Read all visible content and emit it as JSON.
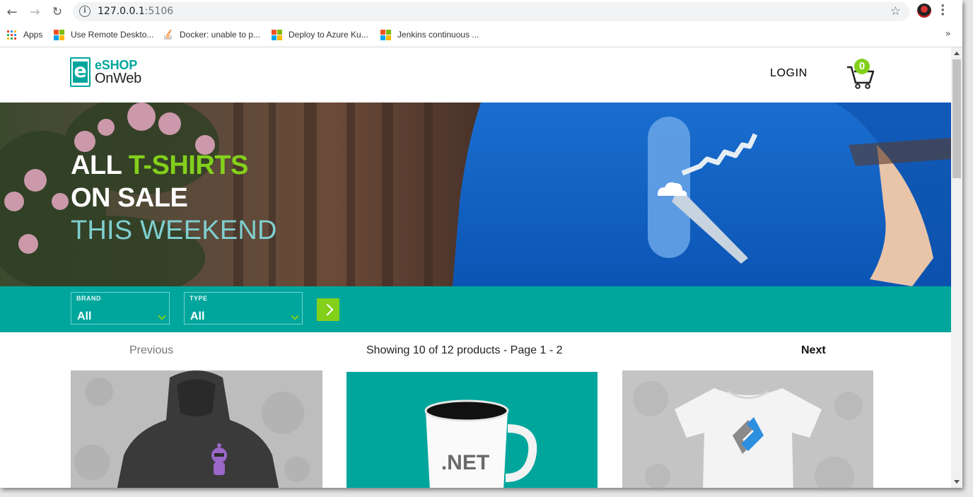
{
  "browser": {
    "url_host": "127.0.0.1",
    "url_port": ":5106",
    "bookmarks": [
      {
        "label": "Apps",
        "icon": "apps-grid-icon"
      },
      {
        "label": "Use Remote Deskto...",
        "icon": "microsoft-logo-icon"
      },
      {
        "label": "Docker: unable to p...",
        "icon": "stackoverflow-icon"
      },
      {
        "label": "Deploy to Azure Ku...",
        "icon": "microsoft-logo-icon"
      },
      {
        "label": "Jenkins continuous ...",
        "icon": "microsoft-logo-icon"
      }
    ],
    "more_bookmarks": "»"
  },
  "header": {
    "logo_line1": "eSHOP",
    "logo_line2": "OnWeb",
    "logo_letter": "e",
    "login_label": "LOGIN",
    "cart_count": "0"
  },
  "hero": {
    "line1_a": "ALL ",
    "line1_b": "T-SHIRTS",
    "line2": "ON SALE",
    "line3": "THIS WEEKEND"
  },
  "filters": {
    "brand_label": "BRAND",
    "brand_value": "All",
    "type_label": "TYPE",
    "type_value": "All"
  },
  "pager": {
    "previous": "Previous",
    "showing": "Showing 10 of 12 products - Page 1 - 2",
    "next": "Next"
  },
  "products": [
    {
      "image": "black-hoodie-with-bot-mascot"
    },
    {
      "image": "dotnet-white-mug-on-teal"
    },
    {
      "image": "white-tshirt-with-logo"
    }
  ],
  "mug_text": ".NET",
  "colors": {
    "brand_teal": "#00a69c",
    "accent_green": "#83d01b"
  }
}
